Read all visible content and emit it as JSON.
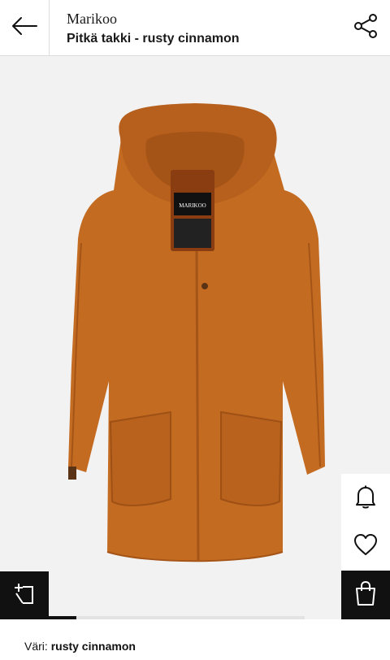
{
  "header": {
    "back_icon": "arrow-left-icon",
    "brand": "Marikoo",
    "product_title": "Pitkä takki - rusty cinnamon",
    "share_icon": "share-icon"
  },
  "gallery": {
    "image": "orange hooded wool coat",
    "coat_label_top": "MARIKOO",
    "actions": {
      "notify_icon": "bell-icon",
      "wishlist_icon": "heart-icon",
      "bag_icon": "shopping-bag-icon",
      "compare_icon": "compare-icon"
    },
    "progress_fraction": 0.25
  },
  "details": {
    "color_label": "Väri:",
    "color_value": "rusty cinnamon"
  },
  "colors": {
    "coat": "#c46b22",
    "coat_shadow": "#a55417",
    "background": "#f2f2f2",
    "dark": "#111111"
  }
}
